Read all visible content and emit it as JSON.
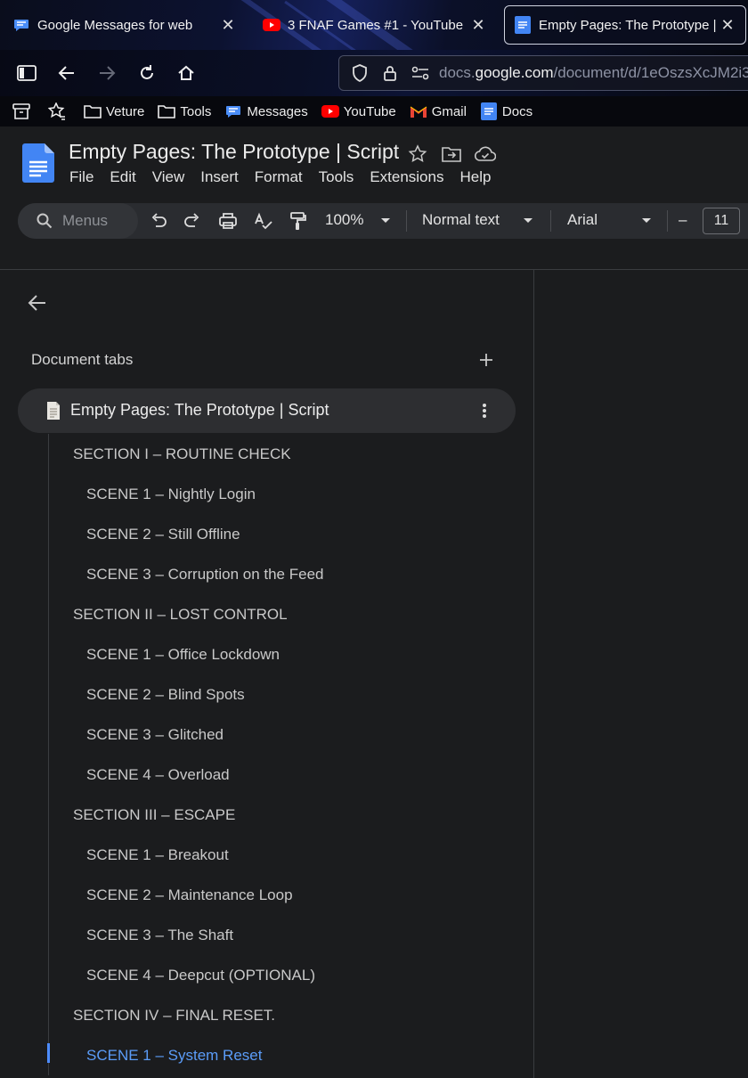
{
  "browser": {
    "tabs": [
      {
        "title": "Google Messages for web",
        "icon": "messages-icon",
        "close": "✕"
      },
      {
        "title": "3 FNAF Games #1 - YouTube",
        "icon": "youtube-icon",
        "close": "✕"
      },
      {
        "title": "Empty Pages: The Prototype | Sc",
        "icon": "docs-icon",
        "close": "✕",
        "active": true
      }
    ],
    "url": {
      "scheme": "docs.",
      "host": "google.com",
      "path": "/document/d/1eOszsXcJM2i3"
    },
    "bookmarks": [
      {
        "label": "Veture",
        "icon": "folder-icon"
      },
      {
        "label": "Tools",
        "icon": "folder-icon"
      },
      {
        "label": "Messages",
        "icon": "messages-icon"
      },
      {
        "label": "YouTube",
        "icon": "youtube-icon"
      },
      {
        "label": "Gmail",
        "icon": "gmail-icon"
      },
      {
        "label": "Docs",
        "icon": "docs-icon"
      }
    ]
  },
  "doc": {
    "title": "Empty Pages: The Prototype | Script",
    "menu": [
      "File",
      "Edit",
      "View",
      "Insert",
      "Format",
      "Tools",
      "Extensions",
      "Help"
    ]
  },
  "toolbar": {
    "search_placeholder": "Menus",
    "zoom": "100%",
    "style": "Normal text",
    "font": "Arial",
    "font_size_minus": "–",
    "font_size": "11"
  },
  "outline": {
    "heading": "Document tabs",
    "tab_name": "Empty Pages: The Prototype | Script",
    "items": [
      {
        "text": "SECTION I – ROUTINE CHECK",
        "level": 1
      },
      {
        "text": "SCENE 1 – Nightly Login",
        "level": 2
      },
      {
        "text": "SCENE 2 – Still Offline",
        "level": 2
      },
      {
        "text": "SCENE 3 – Corruption on the Feed",
        "level": 2
      },
      {
        "text": "SECTION II – LOST CONTROL",
        "level": 1
      },
      {
        "text": "SCENE 1 – Office Lockdown",
        "level": 2
      },
      {
        "text": "SCENE 2 – Blind Spots",
        "level": 2
      },
      {
        "text": "SCENE 3 – Glitched",
        "level": 2
      },
      {
        "text": "SCENE 4 – Overload",
        "level": 2
      },
      {
        "text": "SECTION III – ESCAPE",
        "level": 1
      },
      {
        "text": "SCENE 1 – Breakout",
        "level": 2
      },
      {
        "text": "SCENE 2 – Maintenance Loop",
        "level": 2
      },
      {
        "text": "SCENE 3 – The Shaft",
        "level": 2
      },
      {
        "text": "SCENE 4 – Deepcut (OPTIONAL)",
        "level": 2
      },
      {
        "text": "SECTION IV – FINAL RESET.",
        "level": 1
      },
      {
        "text": "SCENE 1 – System Reset",
        "level": 2,
        "active": true
      }
    ]
  },
  "colors": {
    "accent": "#5b9cf8",
    "panel_bg": "#1b1c1e",
    "toolbar_bg": "#2a2c30"
  }
}
